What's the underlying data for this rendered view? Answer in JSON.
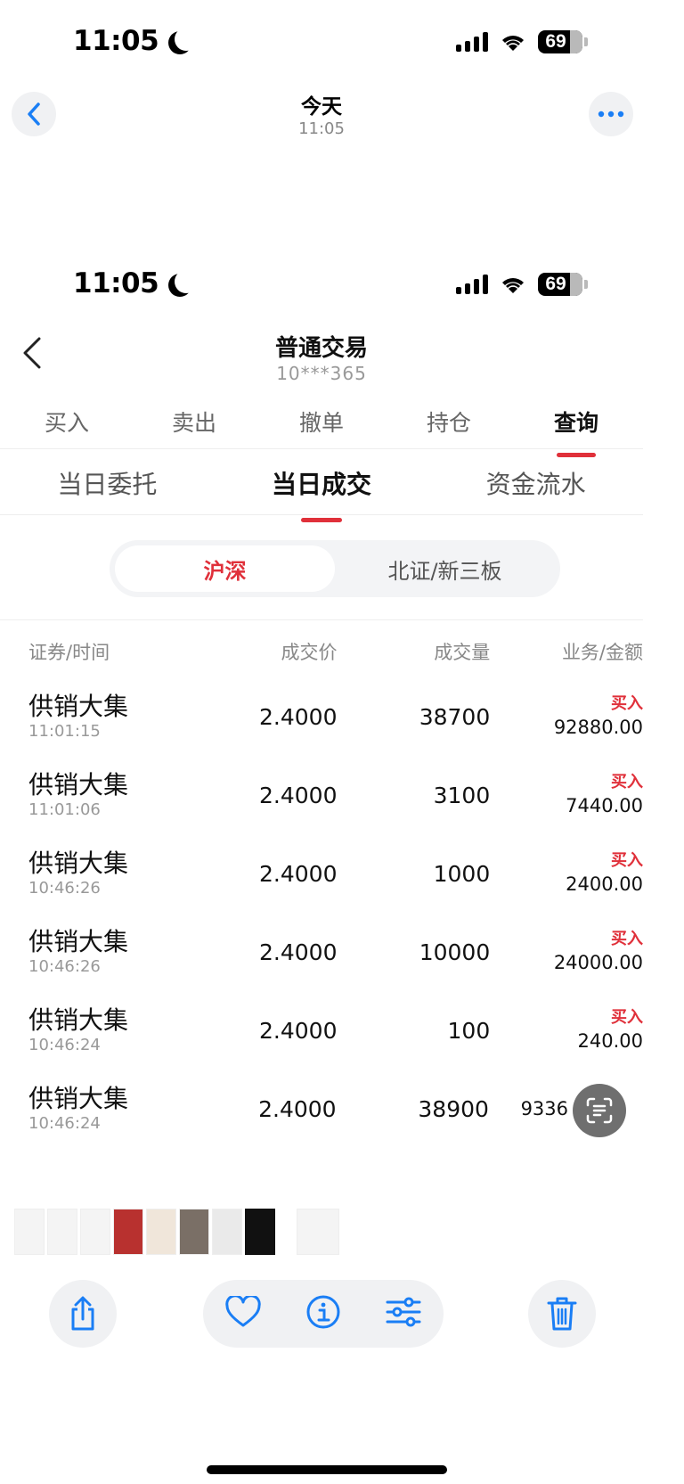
{
  "status_bar_top": {
    "time": "11:05",
    "battery": "69"
  },
  "viewer_header": {
    "title": "今天",
    "subtitle": "11:05"
  },
  "status_bar_inner": {
    "time": "11:05",
    "battery": "69"
  },
  "app_header": {
    "title": "普通交易",
    "account": "10***365"
  },
  "main_tabs": [
    {
      "label": "买入"
    },
    {
      "label": "卖出"
    },
    {
      "label": "撤单"
    },
    {
      "label": "持仓"
    },
    {
      "label": "查询",
      "active": true
    }
  ],
  "sub_tabs": [
    {
      "label": "当日委托"
    },
    {
      "label": "当日成交",
      "active": true
    },
    {
      "label": "资金流水"
    }
  ],
  "segment": [
    {
      "label": "沪深",
      "active": true
    },
    {
      "label": "北证/新三板"
    }
  ],
  "table": {
    "headers": [
      "证券/时间",
      "成交价",
      "成交量",
      "业务/金额"
    ],
    "rows": [
      {
        "name": "供销大集",
        "time": "11:01:15",
        "price": "2.4000",
        "volume": "38700",
        "action": "买入",
        "amount": "92880.00"
      },
      {
        "name": "供销大集",
        "time": "11:01:06",
        "price": "2.4000",
        "volume": "3100",
        "action": "买入",
        "amount": "7440.00"
      },
      {
        "name": "供销大集",
        "time": "10:46:26",
        "price": "2.4000",
        "volume": "1000",
        "action": "买入",
        "amount": "2400.00"
      },
      {
        "name": "供销大集",
        "time": "10:46:26",
        "price": "2.4000",
        "volume": "10000",
        "action": "买入",
        "amount": "24000.00"
      },
      {
        "name": "供销大集",
        "time": "10:46:24",
        "price": "2.4000",
        "volume": "100",
        "action": "买入",
        "amount": "240.00"
      },
      {
        "name": "供销大集",
        "time": "10:46:24",
        "price": "2.4000",
        "volume": "38900",
        "action": "",
        "amount": "9336"
      }
    ]
  },
  "colors": {
    "accent_red": "#e0303a",
    "ios_blue": "#1a7ef5"
  },
  "icons": [
    "back-chevron-icon",
    "more-icon",
    "ocr-scan-icon",
    "share-icon",
    "heart-icon",
    "info-icon",
    "adjust-icon",
    "trash-icon"
  ]
}
